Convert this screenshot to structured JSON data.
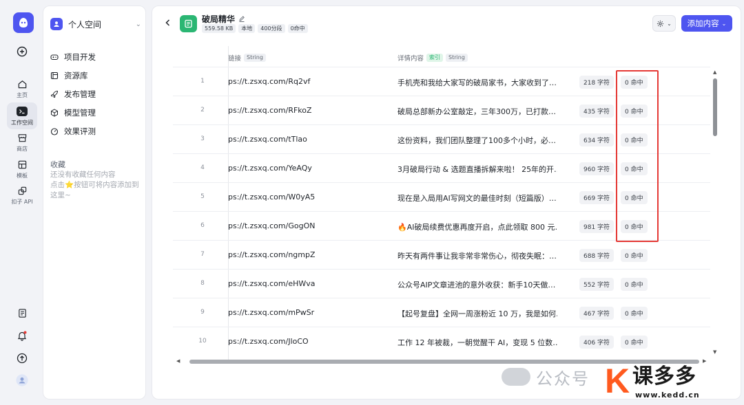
{
  "rail": {
    "home_label": "主页",
    "workspace_label": "工作空间",
    "store_label": "商店",
    "template_label": "模板",
    "api_label": "扣子 API"
  },
  "sidebar": {
    "space_name": "个人空间",
    "items": [
      {
        "label": "项目开发",
        "icon": "gamepad-icon"
      },
      {
        "label": "资源库",
        "icon": "library-icon"
      },
      {
        "label": "发布管理",
        "icon": "rocket-icon"
      },
      {
        "label": "模型管理",
        "icon": "cube-icon"
      },
      {
        "label": "效果评测",
        "icon": "gauge-icon"
      }
    ],
    "favorites_title": "收藏",
    "favorites_tip_1": "还没有收藏任何内容",
    "favorites_tip_2": "点击⭐按钮可将内容添加到",
    "favorites_tip_3": "这里~"
  },
  "header": {
    "title": "破局精华",
    "tags": [
      "559.58 KB",
      "本地",
      "400分段",
      "0命中"
    ],
    "add_label": "添加内容"
  },
  "table": {
    "col_link": "链接",
    "col_link_type": "String",
    "col_detail": "详情内容",
    "col_detail_index": "索引",
    "col_detail_type": "String",
    "rows": [
      {
        "idx": "1",
        "link": "ps://t.zsxq.com/Rq2vf",
        "detail": "手机壳和我给大家写的破局家书，大家收到了…",
        "chars": "218 字符",
        "hits": "0 命中"
      },
      {
        "idx": "2",
        "link": "ps://t.zsxq.com/RFkoZ",
        "detail": "破局总部新办公室敲定，三年300万，已打款…",
        "chars": "435 字符",
        "hits": "0 命中"
      },
      {
        "idx": "3",
        "link": "ps://t.zsxq.com/tTlao",
        "detail": "这份资料，我们团队整理了100多个小时，必…",
        "chars": "634 字符",
        "hits": "0 命中"
      },
      {
        "idx": "4",
        "link": "ps://t.zsxq.com/YeAQy",
        "detail": "3月破局行动 & 选题直播拆解来啦！ 25年的开…",
        "chars": "960 字符",
        "hits": "0 命中"
      },
      {
        "idx": "5",
        "link": "ps://t.zsxq.com/W0yA5",
        "detail": "现在是入局用AI写网文的最佳时刻（短篇版）…",
        "chars": "669 字符",
        "hits": "0 命中"
      },
      {
        "idx": "6",
        "link": "ps://t.zsxq.com/GogON",
        "detail": "🔥AI破局续费优惠再度开启，点此领取 800 元…",
        "chars": "981 字符",
        "hits": "0 命中"
      },
      {
        "idx": "7",
        "link": "ps://t.zsxq.com/ngmpZ",
        "detail": "昨天有两件事让我非常非常伤心，彻夜失眠：…",
        "chars": "688 字符",
        "hits": "0 命中"
      },
      {
        "idx": "8",
        "link": "ps://t.zsxq.com/eHWva",
        "detail": "公众号AIP文章进池的意外收获：新手10天做…",
        "chars": "552 字符",
        "hits": "0 命中"
      },
      {
        "idx": "9",
        "link": "ps://t.zsxq.com/mPwSr",
        "detail": "【起号复盘】全网一周涨粉近 10 万，我是如何…",
        "chars": "467 字符",
        "hits": "0 命中"
      },
      {
        "idx": "10",
        "link": "ps://t.zsxq.com/JloCO",
        "detail": "工作 12 年被裁，一朝觉醒干 AI，变现 5 位数…",
        "chars": "406 字符",
        "hits": "0 命中"
      }
    ]
  },
  "watermark": {
    "wechat_text": "公众号",
    "brand_letter": "K",
    "brand_name": "课多多",
    "brand_url": "www.kedd.cn"
  },
  "colors": {
    "accent": "#4e55f0",
    "db_green": "#2bb673",
    "highlight_red": "#e53935",
    "brand_orange": "#ff5a1f"
  }
}
